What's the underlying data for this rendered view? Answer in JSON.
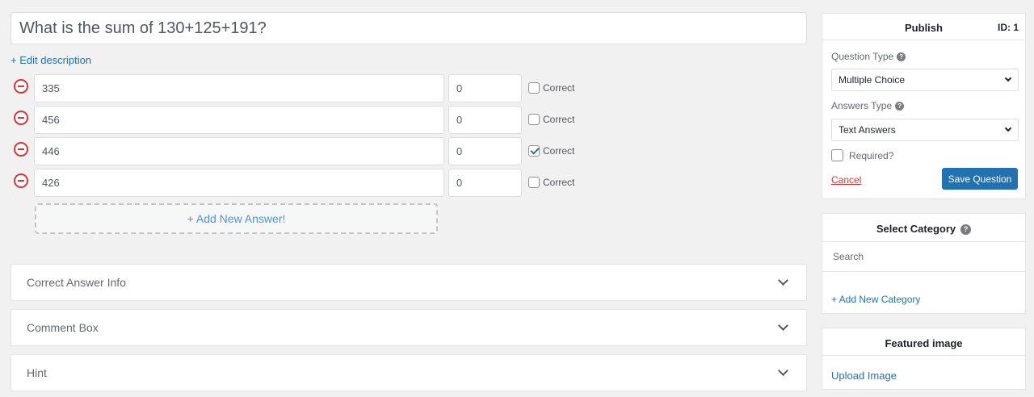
{
  "question": {
    "title": "What is the sum of 130+125+191?",
    "edit_description": "+ Edit description"
  },
  "answers": [
    {
      "text": "335",
      "points": "0",
      "correct": false,
      "correct_label": "Correct"
    },
    {
      "text": "456",
      "points": "0",
      "correct": false,
      "correct_label": "Correct"
    },
    {
      "text": "446",
      "points": "0",
      "correct": true,
      "correct_label": "Correct"
    },
    {
      "text": "426",
      "points": "0",
      "correct": false,
      "correct_label": "Correct"
    }
  ],
  "add_answer_label": "+ Add New Answer!",
  "accordions": [
    {
      "title": "Correct Answer Info"
    },
    {
      "title": "Comment Box"
    },
    {
      "title": "Hint"
    }
  ],
  "publish": {
    "title": "Publish",
    "id_label": "ID: 1",
    "question_type_label": "Question Type",
    "question_type_value": "Multiple Choice",
    "answers_type_label": "Answers Type",
    "answers_type_value": "Text Answers",
    "required_label": "Required?",
    "cancel_label": "Cancel",
    "save_label": "Save Question"
  },
  "category": {
    "title": "Select Category",
    "search_placeholder": "Search",
    "add_label": "+ Add New Category"
  },
  "featured": {
    "title": "Featured image",
    "upload_label": "Upload Image"
  },
  "icons": {
    "remove": "minus-circle-icon",
    "help": "question-circle-icon",
    "chevron": "chevron-down-icon",
    "checkbox": "check-icon"
  },
  "colors": {
    "accent": "#2271b1",
    "danger": "#d63638",
    "background": "#f1f1f1"
  }
}
